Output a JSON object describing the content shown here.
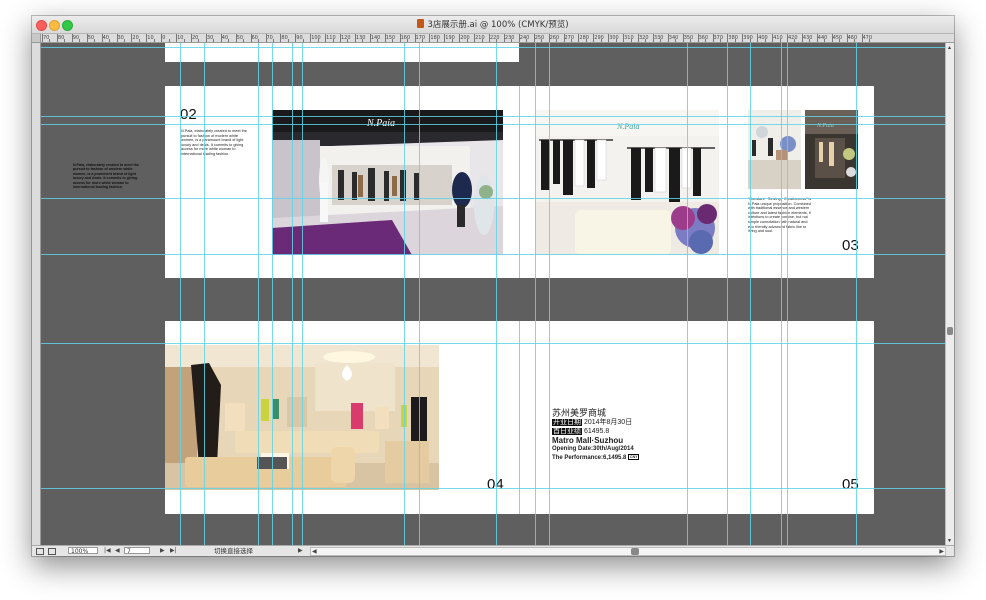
{
  "window": {
    "title": "3店展示册.ai @ 100% (CMYK/预览)"
  },
  "ruler": {
    "labels": [
      "70",
      "80",
      "90",
      "50",
      "40",
      "30",
      "20",
      "10",
      "0",
      "10",
      "20",
      "30",
      "40",
      "50",
      "60",
      "70",
      "80",
      "90",
      "100",
      "110",
      "120",
      "130",
      "140",
      "150",
      "160",
      "170",
      "180",
      "190",
      "200",
      "210",
      "220",
      "230",
      "240",
      "250",
      "260",
      "270",
      "280",
      "290",
      "300",
      "310",
      "320",
      "330",
      "340",
      "350",
      "360",
      "370",
      "380",
      "390",
      "400",
      "410",
      "420",
      "430",
      "440",
      "450",
      "460",
      "470"
    ]
  },
  "artboards": {
    "page_02": {
      "number": "02",
      "text": "N.Paia, elaborately created to meet the pursuit to fashion of modern white women, is a paramount brand of light luxury and deals. It commits to giving access for more white woman to international leading fashion."
    },
    "outside_note": "N.Paia, elaborately created to meet the pursuit to fashion of western white women, is a prominent brand of light luxury and deals. It commits to giving access for more white woman to international leading fashion.",
    "page_03": {
      "number": "03",
      "text": "\"Constant · Striving · Creativeness\" is N.Paia unique proposition. Combined with traditional essence and western culture and latest fashion elements, it intentions to create concise, but not simple connotation with natural and eco friendly advanced fabric like to living and soul."
    },
    "page_04": {
      "number": "04"
    },
    "page_05": {
      "number": "05",
      "cn_title": "苏州美罗商城",
      "cn_opening_label": "开业日期",
      "cn_opening_value": "2014年8月30日",
      "cn_performance_label": "首日业绩",
      "cn_performance_value": "61495.8",
      "en_title": "Matro Mall·Suzhou",
      "en_opening": "Opening Date:30th/Aug/2014",
      "en_performance": "The Performance:6,1495.8",
      "currency": "CNY"
    }
  },
  "statusbar": {
    "zoom": "100%",
    "page_field": "7",
    "tool_status": "切换直接选择",
    "nav_first": "|◀",
    "nav_prev": "◀",
    "nav_next": "▶",
    "nav_last": "▶|",
    "scroll_left": "◀",
    "scroll_right": "▶"
  },
  "icons": {
    "file": "ai-file-icon",
    "scroll_up": "triangle-up-icon",
    "scroll_down": "triangle-down-icon"
  },
  "colors": {
    "canvas": "#5f5f5f",
    "guides": "#5fd3e6",
    "artboard": "#ffffff"
  }
}
